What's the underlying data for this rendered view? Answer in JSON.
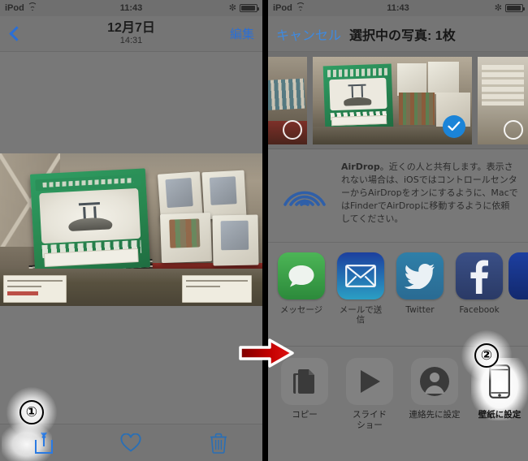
{
  "status_bar": {
    "carrier": "iPod",
    "time": "11:43",
    "wifi_icon": "wifi-icon",
    "bluetooth_icon": "bluetooth-icon",
    "battery_icon": "battery-icon"
  },
  "left_panel": {
    "nav": {
      "back_icon": "back-chevron-icon",
      "title": "12月7日",
      "subtitle": "14:31",
      "edit_label": "編集"
    },
    "photo": {
      "alt": "うどん県学習帳 じゆうちょう ノートが棚に並んでいる写真"
    },
    "toolbar": {
      "share_icon": "share-icon",
      "favorite_icon": "heart-icon",
      "delete_icon": "trash-icon"
    }
  },
  "right_panel": {
    "nav": {
      "cancel_label": "キャンセル",
      "title": "選択中の写真: 1枚"
    },
    "thumbnails": [
      {
        "name": "thumbnail-previous",
        "selected": false,
        "selection_icon": "circle-icon"
      },
      {
        "name": "thumbnail-current",
        "selected": true,
        "selection_icon": "check-circle-icon"
      },
      {
        "name": "thumbnail-next",
        "selected": false,
        "selection_icon": "circle-icon"
      }
    ],
    "airdrop": {
      "icon": "airdrop-icon",
      "bold_prefix": "AirDrop",
      "text": "。近くの人と共有します。表示されない場合は、iOSではコントロールセンターからAirDropをオンにするように、MacではFinderでAirDropに移動するように依頼してください。"
    },
    "share_apps": [
      {
        "label": "メッセージ",
        "icon": "messages-icon"
      },
      {
        "label": "メールで送信",
        "icon": "mail-icon"
      },
      {
        "label": "Twitter",
        "icon": "twitter-icon"
      },
      {
        "label": "Facebook",
        "icon": "facebook-icon"
      }
    ],
    "actions": [
      {
        "label": "コピー",
        "icon": "copy-icon",
        "highlighted": false
      },
      {
        "label": "スライド\nショー",
        "icon": "slideshow-icon",
        "highlighted": false
      },
      {
        "label": "連絡先に設定",
        "icon": "contact-icon",
        "highlighted": false
      },
      {
        "label": "壁紙に設定",
        "icon": "wallpaper-icon",
        "highlighted": true
      }
    ]
  },
  "annotations": {
    "step_one": "①",
    "step_two": "②",
    "arrow": "red-right-arrow"
  },
  "colors": {
    "accent_blue": "#2a7ae2",
    "selection_blue": "#1b84d8",
    "arrow_red": "#cc0000",
    "panel_gray": "#787878"
  }
}
